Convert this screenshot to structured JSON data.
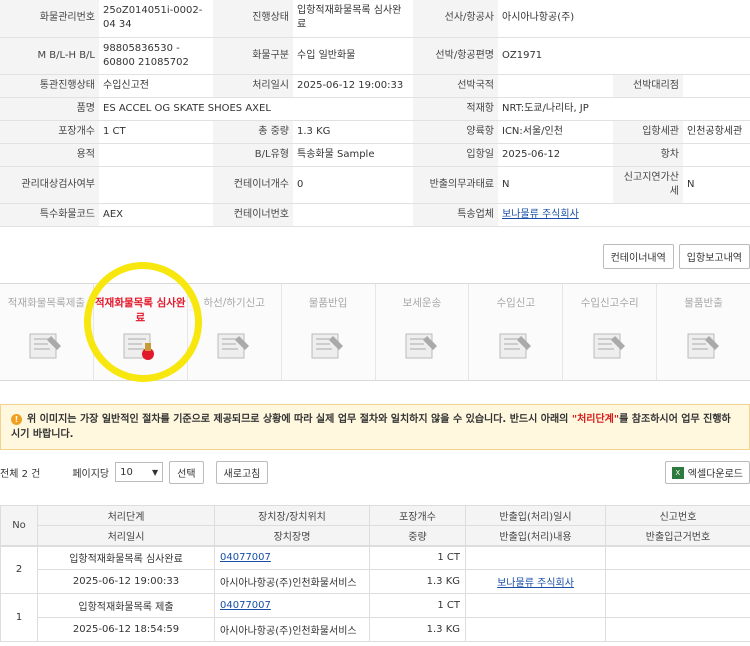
{
  "info": {
    "rows": [
      {
        "l1": "화물관리번호",
        "v1": "25oZ014051i-0002-04 34",
        "l2": "진행상태",
        "v2": "입항적재화물목록 심사완료",
        "l3": "선사/항공사",
        "v3": "아시아나항공(주)",
        "l4": "",
        "v4": ""
      },
      {
        "l1": "M B/L-H B/L",
        "v1": "98805836530 - 60800 21085702",
        "l2": "화물구분",
        "v2": "수입 일반화물",
        "l3": "선박/항공편명",
        "v3": "OZ1971",
        "l4": "",
        "v4": ""
      },
      {
        "l1": "통관진행상태",
        "v1": "수입신고전",
        "l2": "처리일시",
        "v2": "2025-06-12 19:00:33",
        "l3": "선박국적",
        "v3": "",
        "l4": "선박대리점",
        "v4": ""
      },
      {
        "l1": "품명",
        "v1": "ES ACCEL OG SKATE SHOES AXEL",
        "l2": "",
        "v2": "",
        "l3": "적재항",
        "v3": "NRT:도쿄/나리타, JP",
        "l4": "",
        "v4": ""
      },
      {
        "l1": "포장개수",
        "v1": "1 CT",
        "l2": "총 중량",
        "v2": "1.3 KG",
        "l3": "양륙항",
        "v3": "ICN:서울/인천",
        "l4": "입항세관",
        "v4": "인천공항세관"
      },
      {
        "l1": "용적",
        "v1": "",
        "l2": "B/L유형",
        "v2": "특송화물 Sample",
        "l3": "입항일",
        "v3": "2025-06-12",
        "l4": "항차",
        "v4": ""
      },
      {
        "l1": "관리대상검사여부",
        "v1": "",
        "l2": "컨테이너개수",
        "v2": "0",
        "l3": "반출의무과태료",
        "v3": "N",
        "l4": "신고지연가산세",
        "v4": "N"
      },
      {
        "l1": "특수화물코드",
        "v1": "AEX",
        "l2": "컨테이너번호",
        "v2": "",
        "l3": "특송업체",
        "v3": "보나물류 주식회사",
        "l4": "",
        "v4": ""
      }
    ]
  },
  "buttons": {
    "container": "컨테이너내역",
    "report": "입항보고내역"
  },
  "steps": [
    {
      "label": "적재화물목록제출",
      "icon": "document-pen-icon"
    },
    {
      "label": "적재화물목록 심사완료",
      "icon": "approval-stamp-icon",
      "active": true
    },
    {
      "label": "하선/하기신고",
      "icon": "clipboard-icon"
    },
    {
      "label": "물품반입",
      "icon": "boxes-icon"
    },
    {
      "label": "보세운송",
      "icon": "forklift-icon"
    },
    {
      "label": "수입신고",
      "icon": "document-write-icon"
    },
    {
      "label": "수입신고수리",
      "icon": "certificate-icon"
    },
    {
      "label": "물품반출",
      "icon": "release-icon"
    }
  ],
  "notice": {
    "text1": "위 이미지는 가장 일반적인 절차를 기준으로 제공되므로 상황에 따라 실제 업무 절차와 일치하지 않을 수 있습니다. 반드시 아래의 ",
    "highlight": "\"처리단계\"",
    "text2": "를 참조하시어 업무 진행하시기 바랍니다."
  },
  "toolbar": {
    "total": "전체 2 건",
    "perpage": "페이지당",
    "perpage_value": "10",
    "select": "선택",
    "refresh": "새로고침",
    "excel": "엑셀다운로드"
  },
  "grid": {
    "h1": [
      "No",
      "처리단계",
      "장치장/장치위치",
      "포장개수",
      "반출입(처리)일시",
      "신고번호"
    ],
    "h2": [
      "처리일시",
      "장치장명",
      "중량",
      "반출입(처리)내용",
      "반출입근거번호"
    ],
    "rows": [
      {
        "no": "2",
        "step": "입항적재화물목록 심사완료",
        "loc": "04077007",
        "pkg": "1 CT",
        "io_time": "",
        "report": "",
        "time": "2025-06-12 19:00:33",
        "locname": "아시아나항공(주)인천화물서비스",
        "weight": "1.3 KG",
        "io_content": "보나물류 주식회사",
        "basis": ""
      },
      {
        "no": "1",
        "step": "입항적재화물목록 제출",
        "loc": "04077007",
        "pkg": "1 CT",
        "io_time": "",
        "report": "",
        "time": "2025-06-12 18:54:59",
        "locname": "아시아나항공(주)인천화물서비스",
        "weight": "1.3 KG",
        "io_content": "",
        "basis": ""
      }
    ]
  }
}
